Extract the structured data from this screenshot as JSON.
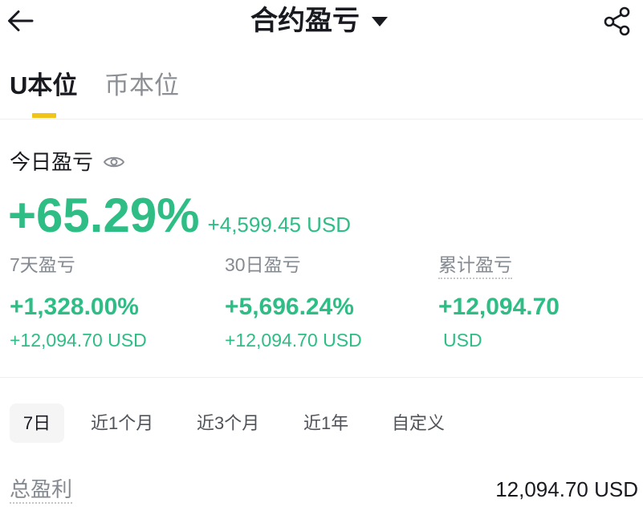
{
  "header": {
    "title": "合约盈亏",
    "back_icon": "arrow-left-icon",
    "dropdown_icon": "caret-down-icon",
    "share_icon": "share-icon"
  },
  "tabs": [
    {
      "label": "U本位",
      "active": true
    },
    {
      "label": "币本位",
      "active": false
    }
  ],
  "today": {
    "label": "今日盈亏",
    "visibility_icon": "eye-icon",
    "percent": "+65.29%",
    "amount": "+4,599.45 USD"
  },
  "stats": [
    {
      "label": "7天盈亏",
      "primary": "+1,328.00%",
      "secondary": "+12,094.70 USD"
    },
    {
      "label": "30日盈亏",
      "primary": "+5,696.24%",
      "secondary": "+12,094.70 USD"
    },
    {
      "label": "累计盈亏",
      "primary": "+12,094.70",
      "secondary": "USD"
    }
  ],
  "periods": [
    {
      "label": "7日",
      "selected": true
    },
    {
      "label": "近1个月",
      "selected": false
    },
    {
      "label": "近3个月",
      "selected": false
    },
    {
      "label": "近1年",
      "selected": false
    },
    {
      "label": "自定义",
      "selected": false
    }
  ],
  "summary": {
    "label": "总盈利",
    "value": "12,094.70 USD"
  },
  "colors": {
    "profit": "#2ebd85",
    "accent": "#f0c419",
    "text": "#181a20",
    "muted": "#858a91",
    "tabbg": "#f5f5f5",
    "divider": "#eeeeee"
  }
}
